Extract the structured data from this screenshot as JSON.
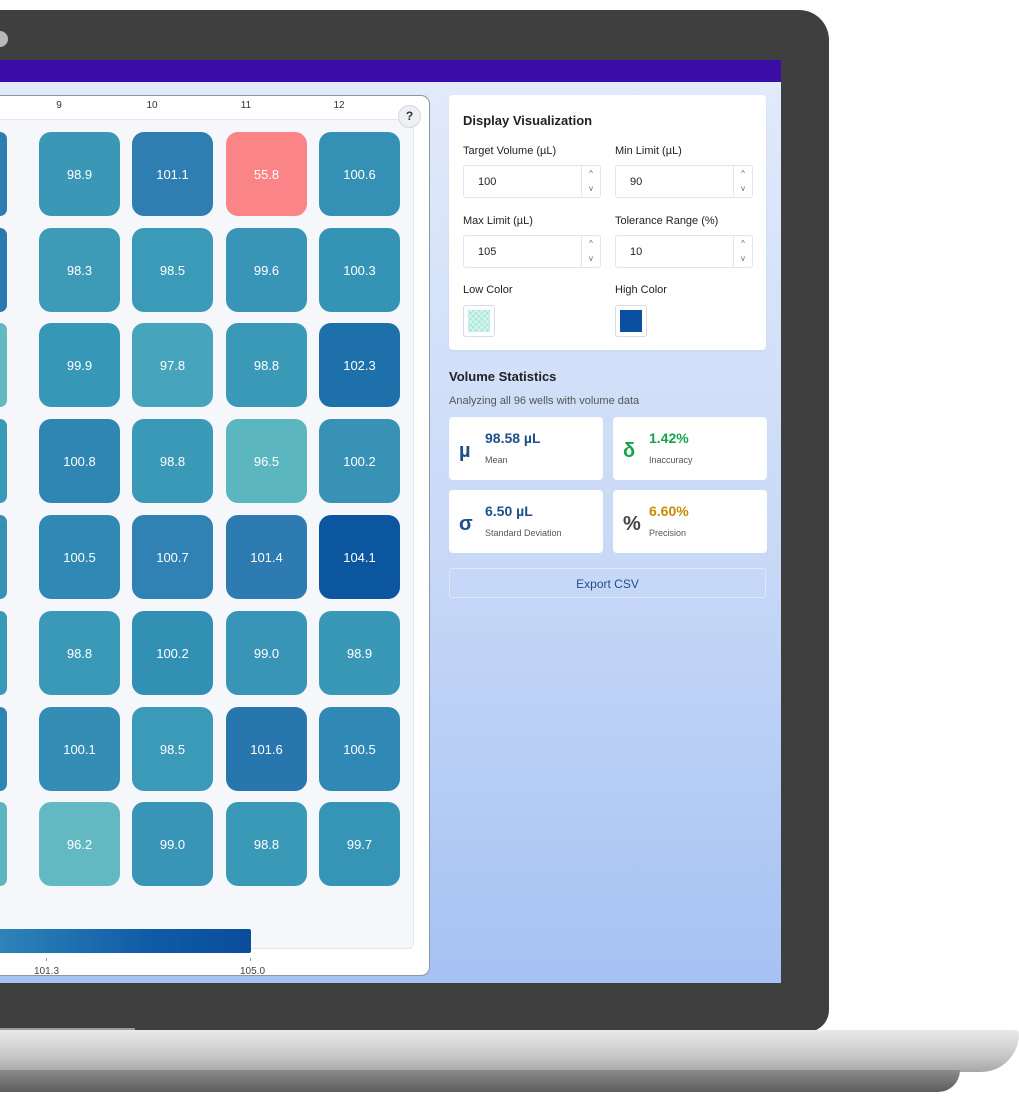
{
  "plate": {
    "column_headers": [
      "9",
      "10",
      "11",
      "12"
    ],
    "help_label": "?",
    "rows": [
      [
        "98.9",
        "101.1",
        "55.8",
        "100.6"
      ],
      [
        "98.3",
        "98.5",
        "99.6",
        "100.3"
      ],
      [
        "99.9",
        "97.8",
        "98.8",
        "102.3"
      ],
      [
        "100.8",
        "98.8",
        "96.5",
        "100.2"
      ],
      [
        "100.5",
        "100.7",
        "101.4",
        "104.1"
      ],
      [
        "98.8",
        "100.2",
        "99.0",
        "98.9"
      ],
      [
        "100.1",
        "98.5",
        "101.6",
        "100.5"
      ],
      [
        "96.2",
        "99.0",
        "98.8",
        "99.7"
      ]
    ],
    "colors": [
      [
        "#3a97b6",
        "#2f7eb2",
        "#fb8487",
        "#3491b5"
      ],
      [
        "#3d9bb8",
        "#3b9ab8",
        "#3895b7",
        "#3593b6"
      ],
      [
        "#3797b6",
        "#46a5bc",
        "#3b99b8",
        "#1e70aa"
      ],
      [
        "#2f86b2",
        "#3b99b8",
        "#5cb6c0",
        "#3792b6"
      ],
      [
        "#3089b4",
        "#2f82b3",
        "#2d7bb1",
        "#0b569f"
      ],
      [
        "#3b99b8",
        "#3390b5",
        "#3895b7",
        "#3a98b7"
      ],
      [
        "#348db5",
        "#3b9ab8",
        "#2876ae",
        "#3089b4"
      ],
      [
        "#62b9c1",
        "#3895b7",
        "#3b99b8",
        "#3694b6"
      ]
    ],
    "left_colors": [
      "#2f7eb2",
      "#2a78ad",
      "#62b9c1",
      "#3b99b8",
      "#3791b5",
      "#3b99b8",
      "#2e84b3",
      "#5cb6c0"
    ]
  },
  "legend": {
    "labels": [
      "101.3",
      "105.0"
    ]
  },
  "display": {
    "title": "Display Visualization",
    "target_label": "Target Volume (µL)",
    "target_value": "100",
    "min_label": "Min Limit (µL)",
    "min_value": "90",
    "max_label": "Max Limit (µL)",
    "max_value": "105",
    "tolerance_label": "Tolerance Range (%)",
    "tolerance_value": "10",
    "low_color_label": "Low Color",
    "high_color_label": "High Color",
    "low_color": "#a8e6d8",
    "high_color": "#0b4fa0"
  },
  "stats": {
    "title": "Volume Statistics",
    "subtitle": "Analyzing all 96 wells with volume data",
    "mean_symbol": "µ",
    "mean_value": "98.58 µL",
    "mean_label": "Mean",
    "inaccuracy_symbol": "δ",
    "inaccuracy_value": "1.42%",
    "inaccuracy_label": "Inaccuracy",
    "sd_symbol": "σ",
    "sd_value": "6.50 µL",
    "sd_label": "Standard Deviation",
    "precision_symbol": "%",
    "precision_value": "6.60%",
    "precision_label": "Precision",
    "export_label": "Export CSV",
    "colors": {
      "mean": "#1f4f8a",
      "inaccuracy": "#17a34a",
      "sd": "#1f4f8a",
      "precision": "#ca8a04",
      "precision_symbol": "#444444"
    }
  },
  "spinner": {
    "up": "^",
    "down": "v"
  }
}
